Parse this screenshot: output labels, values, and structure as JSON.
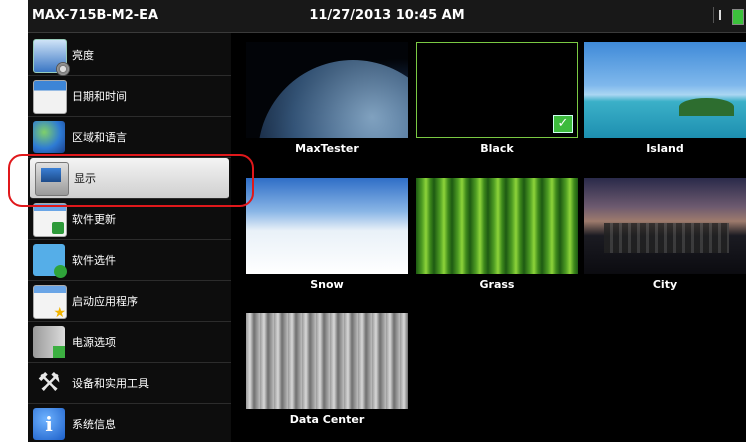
{
  "titlebar": {
    "device_name": "MAX-715B-M2-EA",
    "datetime": "11/27/2013 10:45 AM"
  },
  "sidebar": {
    "items": [
      {
        "label": "亮度",
        "icon": "brightness-icon"
      },
      {
        "label": "日期和时间",
        "icon": "calendar-icon"
      },
      {
        "label": "区域和语言",
        "icon": "globe-icon"
      },
      {
        "label": "显示",
        "icon": "display-icon",
        "selected": true
      },
      {
        "label": "软件更新",
        "icon": "software-update-icon"
      },
      {
        "label": "软件选件",
        "icon": "puzzle-icon"
      },
      {
        "label": "启动应用程序",
        "icon": "startup-apps-icon"
      },
      {
        "label": "电源选项",
        "icon": "power-icon"
      },
      {
        "label": "设备和实用工具",
        "icon": "tools-icon"
      },
      {
        "label": "系统信息",
        "icon": "info-icon"
      }
    ]
  },
  "wallpapers": [
    {
      "name": "MaxTester"
    },
    {
      "name": "Black",
      "selected": true
    },
    {
      "name": "Island"
    },
    {
      "name": "Snow"
    },
    {
      "name": "Grass"
    },
    {
      "name": "City"
    },
    {
      "name": "Data Center"
    }
  ],
  "colors": {
    "selection_ring": "#e0181b",
    "selected_check": "#3dbb3d",
    "battery": "#3cc23c"
  }
}
